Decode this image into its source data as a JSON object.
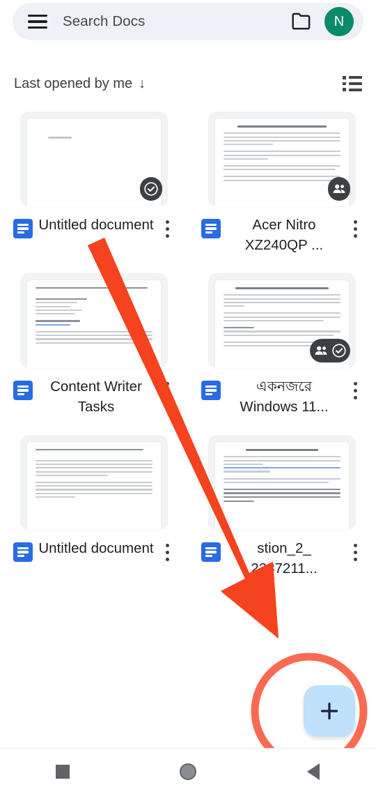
{
  "app": {
    "name": "Google Docs",
    "accent_blue": "#276ce4",
    "avatar_color": "#0b8a6b",
    "fab_color": "#bfe1fb",
    "annotation_color": "#f4503a",
    "highlight_circle_color": "#fa6a52"
  },
  "header": {
    "menu_icon": "hamburger-menu-icon",
    "search_placeholder": "Search Docs",
    "folder_icon": "folder-icon",
    "avatar_initial": "N"
  },
  "sort": {
    "label": "Last opened by me",
    "direction_arrow": "↓",
    "view_toggle_icon": "list-view-icon"
  },
  "documents": [
    {
      "title": "Untitled document",
      "type_icon": "google-docs-icon",
      "badges": [
        "offline-available-check-icon"
      ],
      "menu_icon": "more-options-icon",
      "preview": "blank"
    },
    {
      "title": "Acer Nitro XZ240QP ...",
      "type_icon": "google-docs-icon",
      "badges": [
        "shared-people-icon"
      ],
      "menu_icon": "more-options-icon",
      "preview": "acer-nitro-article"
    },
    {
      "title": "Content Writer Tasks",
      "type_icon": "google-docs-icon",
      "badges": [],
      "menu_icon": "more-options-icon",
      "preview": "content-writer-tasks"
    },
    {
      "title": "একনজরে Windows 11...",
      "type_icon": "google-docs-icon",
      "badges": [
        "shared-people-icon",
        "offline-available-check-icon"
      ],
      "menu_icon": "more-options-icon",
      "preview": "bengali-windows11"
    },
    {
      "title": "Untitled document",
      "type_icon": "google-docs-icon",
      "badges": [],
      "menu_icon": "more-options-icon",
      "preview": "bengali-windows11-doc"
    },
    {
      "title": "stion_2_ 2287211...",
      "type_icon": "google-docs-icon",
      "badges": [],
      "menu_icon": "more-options-icon",
      "preview": "is-cat-scratch-dangerous"
    }
  ],
  "fab": {
    "icon": "plus-icon",
    "label": "Create new document"
  },
  "system_nav": {
    "recents_icon": "recents-square-icon",
    "home_icon": "home-circle-icon",
    "back_icon": "back-triangle-icon"
  },
  "annotation": {
    "arrow": "red-arrow-pointing-to-create-button",
    "circle": "red-circle-highlight-around-create-button"
  }
}
